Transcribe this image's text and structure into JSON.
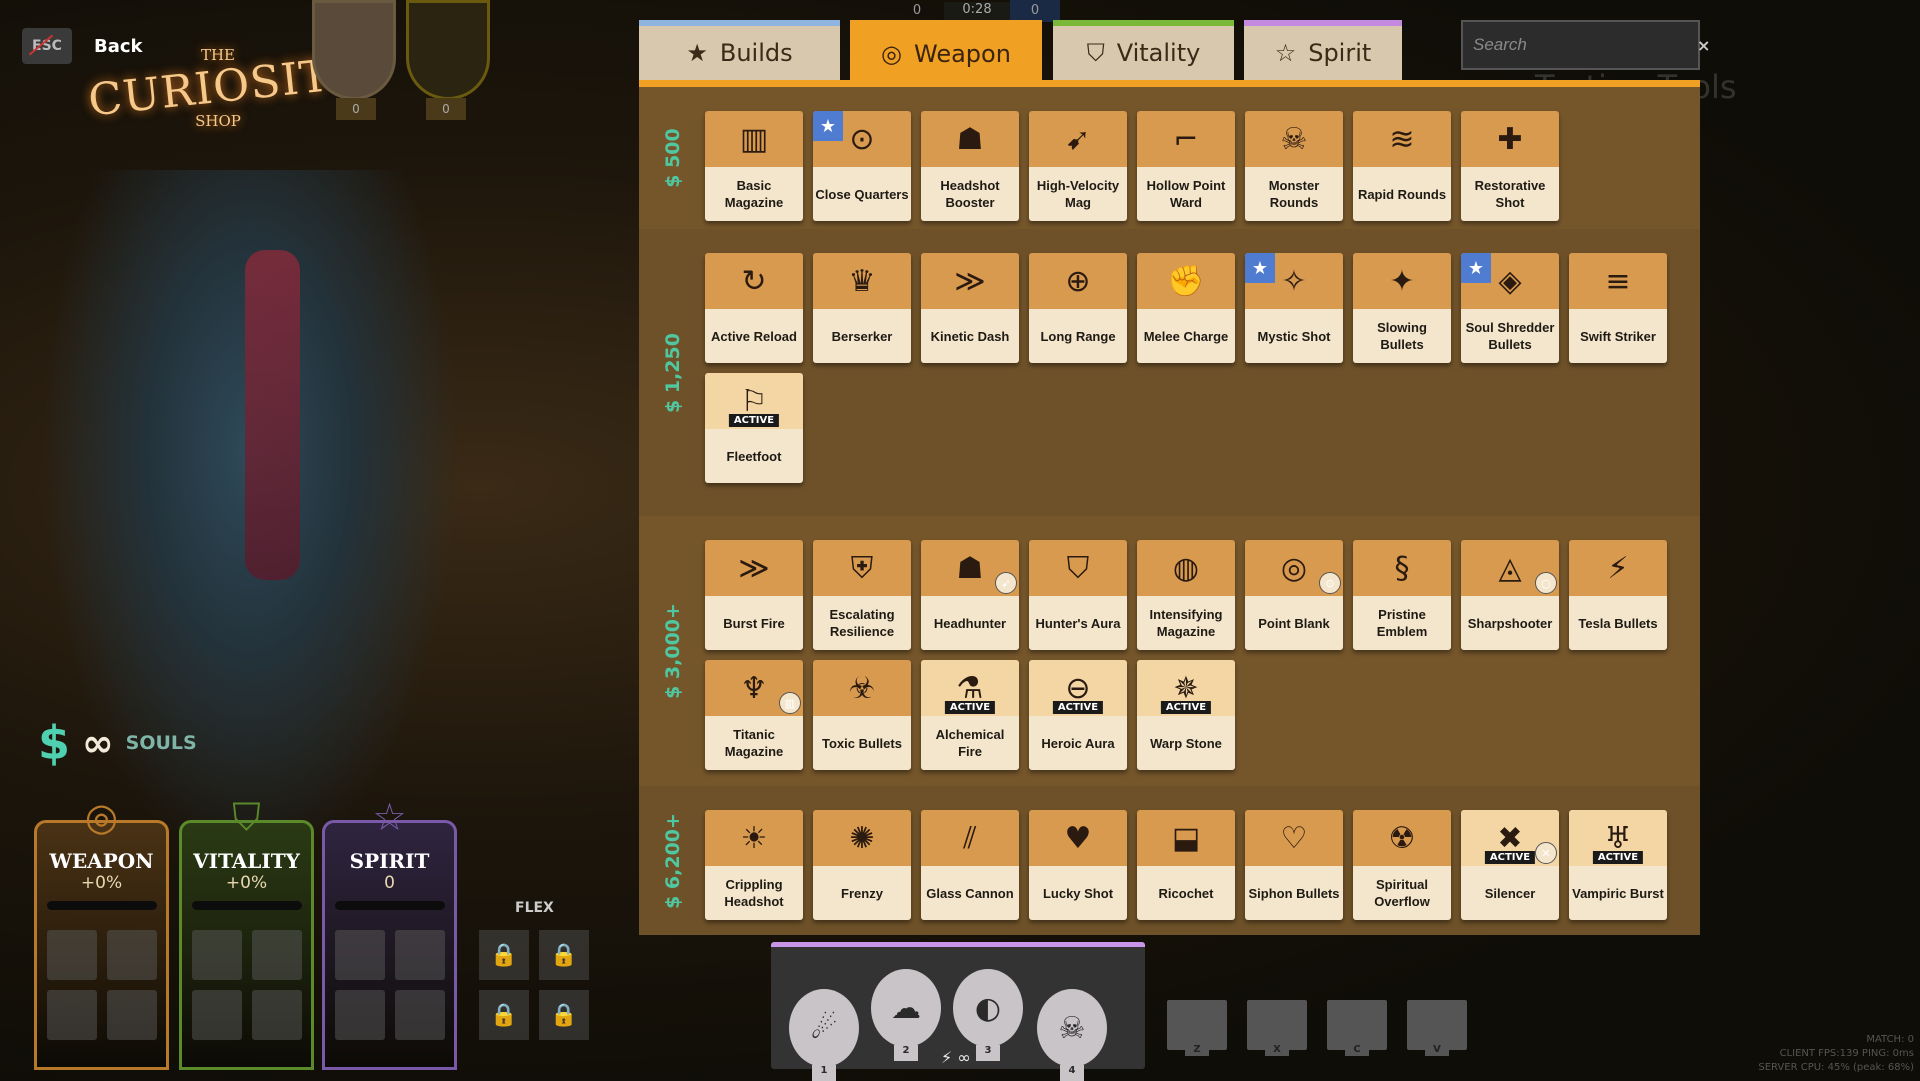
{
  "header": {
    "back_key": "ESC",
    "back_label": "Back",
    "logo": {
      "the": "THE",
      "name": "CURIOSITY",
      "shop": "SHOP"
    },
    "timer": "0:28",
    "team_souls": [
      "0",
      "0"
    ],
    "portrait_counts": [
      "0",
      "0"
    ],
    "testing_tools": "Testing Tools"
  },
  "tabs": [
    {
      "label": "Builds",
      "icon": "★",
      "color": "#8fb4e0",
      "active": false
    },
    {
      "label": "Weapon",
      "icon": "◎",
      "color": "#f0a022",
      "active": true
    },
    {
      "label": "Vitality",
      "icon": "⛉",
      "color": "#7ab83a",
      "active": false
    },
    {
      "label": "Spirit",
      "icon": "☆",
      "color": "#c48ae0",
      "active": false
    }
  ],
  "search": {
    "placeholder": "Search",
    "value": "",
    "clear": "×"
  },
  "colors": {
    "weapon": "#f0a022",
    "vitality": "#7ab83a",
    "spirit": "#b07ae0",
    "souls": "#4fd0b0",
    "favorite": "#4f7bd1"
  },
  "sections": [
    {
      "cost": "$ 500",
      "items": [
        {
          "name": "Basic Magazine",
          "icon": "▥"
        },
        {
          "name": "Close Quarters",
          "icon": "⊙",
          "fav": true
        },
        {
          "name": "Headshot Booster",
          "icon": "☗"
        },
        {
          "name": "High-Velocity Mag",
          "icon": "➹"
        },
        {
          "name": "Hollow Point Ward",
          "icon": "⌐"
        },
        {
          "name": "Monster Rounds",
          "icon": "☠"
        },
        {
          "name": "Rapid Rounds",
          "icon": "≋"
        },
        {
          "name": "Restorative Shot",
          "icon": "✚"
        }
      ]
    },
    {
      "cost": "$ 1,250",
      "items": [
        {
          "name": "Active Reload",
          "icon": "↻"
        },
        {
          "name": "Berserker",
          "icon": "♛"
        },
        {
          "name": "Kinetic Dash",
          "icon": "≫"
        },
        {
          "name": "Long Range",
          "icon": "⊕"
        },
        {
          "name": "Melee Charge",
          "icon": "✊"
        },
        {
          "name": "Mystic Shot",
          "icon": "✧",
          "fav": true
        },
        {
          "name": "Slowing Bullets",
          "icon": "✦"
        },
        {
          "name": "Soul Shredder Bullets",
          "icon": "◈",
          "fav": true
        },
        {
          "name": "Swift Striker",
          "icon": "≡"
        },
        {
          "name": "Fleetfoot",
          "icon": "⚐",
          "active": true
        }
      ]
    },
    {
      "cost": "$ 3,000+",
      "items": [
        {
          "name": "Burst Fire",
          "icon": "≫"
        },
        {
          "name": "Escalating Resilience",
          "icon": "⛨"
        },
        {
          "name": "Headhunter",
          "icon": "☗",
          "dot": "➹"
        },
        {
          "name": "Hunter's Aura",
          "icon": "⛉"
        },
        {
          "name": "Intensifying Magazine",
          "icon": "◍"
        },
        {
          "name": "Point Blank",
          "icon": "◎",
          "dot": "⊙"
        },
        {
          "name": "Pristine Emblem",
          "icon": "§"
        },
        {
          "name": "Sharpshooter",
          "icon": "◬",
          "dot": "○"
        },
        {
          "name": "Tesla Bullets",
          "icon": "⚡"
        },
        {
          "name": "Titanic Magazine",
          "icon": "♆",
          "dot": "▥"
        },
        {
          "name": "Toxic Bullets",
          "icon": "☣"
        },
        {
          "name": "Alchemical Fire",
          "icon": "⚗",
          "active": true
        },
        {
          "name": "Heroic Aura",
          "icon": "⊖",
          "active": true
        },
        {
          "name": "Warp Stone",
          "icon": "✵",
          "active": true
        }
      ]
    },
    {
      "cost": "$ 6,200+",
      "items": [
        {
          "name": "Crippling Headshot",
          "icon": "☀"
        },
        {
          "name": "Frenzy",
          "icon": "✺"
        },
        {
          "name": "Glass Cannon",
          "icon": "⫽"
        },
        {
          "name": "Lucky Shot",
          "icon": "♥"
        },
        {
          "name": "Ricochet",
          "icon": "⬓"
        },
        {
          "name": "Siphon Bullets",
          "icon": "♡"
        },
        {
          "name": "Spiritual Overflow",
          "icon": "☢"
        },
        {
          "name": "Silencer",
          "icon": "✖",
          "active": true,
          "dot": "✕"
        },
        {
          "name": "Vampiric Burst",
          "icon": "♅",
          "active": true
        }
      ]
    }
  ],
  "active_badge": "ACTIVE",
  "souls": {
    "label": "SOULS",
    "icon": "$",
    "value_icon": "∞"
  },
  "stats": [
    {
      "name": "WEAPON",
      "value": "+0%",
      "icon": "◎",
      "color": "#b87a2a",
      "bg": "#4a3214"
    },
    {
      "name": "VITALITY",
      "value": "+0%",
      "icon": "⛉",
      "color": "#5a8a2a",
      "bg": "#2a3a14"
    },
    {
      "name": "SPIRIT",
      "value": "0",
      "icon": "☆",
      "color": "#7a5aa8",
      "bg": "#2e2440"
    }
  ],
  "flex": {
    "label": "FLEX",
    "lock_icon": "🔒"
  },
  "abilities": [
    {
      "key": "1",
      "icon": "☄"
    },
    {
      "key": "2",
      "icon": "☁"
    },
    {
      "key": "3",
      "icon": "◐"
    },
    {
      "key": "4",
      "icon": "☠"
    }
  ],
  "ability_footer": "⚡ ∞",
  "item_slots": [
    "Z",
    "X",
    "C",
    "V"
  ],
  "debug": [
    "MATCH: 0",
    "CLIENT FPS:139   PING: 0ms",
    "SERVER CPU: 45% (peak: 68%)"
  ]
}
